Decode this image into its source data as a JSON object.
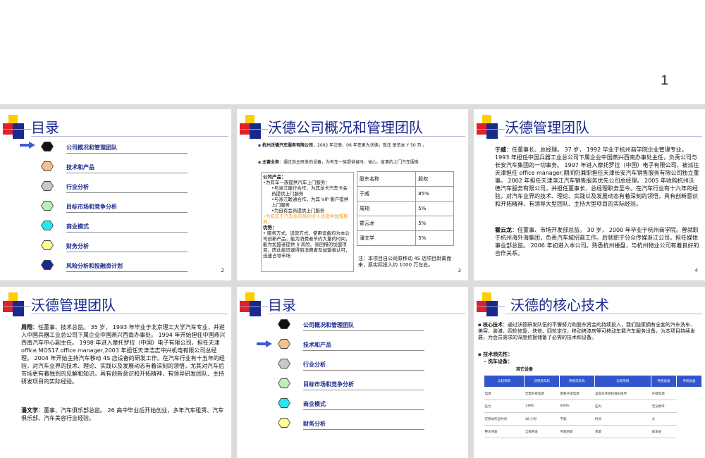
{
  "top": {
    "page": "1"
  },
  "s2": {
    "title": "目录",
    "num": "2",
    "items": [
      {
        "label": "公司概况和管理团队",
        "color": "#111111"
      },
      {
        "label": "技术和产品",
        "color": "#f8c08c"
      },
      {
        "label": "行业分析",
        "color": "#c8c8c8"
      },
      {
        "label": "目标市场和竞争分析",
        "color": "#b8f0b8"
      },
      {
        "label": "商业模式",
        "color": "#22e8f0"
      },
      {
        "label": "财务分析",
        "color": "#ffff99"
      },
      {
        "label": "风险分析和投融资计划",
        "color": "#1a2a8c"
      }
    ]
  },
  "s3": {
    "title": "沃德公司概况和管理团队",
    "num": "3",
    "b1_head": "杭州沃德汽车服务有限公司",
    "b1_text": "，2002 年注册，06 年变更为沃德，现注 册资本 Y 50 万 。",
    "b2_head": "主营业务",
    "b2_text": "：通过自主研发的设备，为有车一族提供省时、省心、省事的上门汽车服务",
    "box_head": "公司产品：",
    "box_lines": [
      "•为有车一族提供汽车上门服务：",
      "•与浙江建行合作，为其龙卡汽车卡会员提供上门服务",
      "•与浙江联通合作，为其 VIP 客户提供上门服务",
      "•为自有会员提供上门服务"
    ],
    "box_orange": "•为有志于汽车后市场创业人员提供加盟服务。",
    "adv_head": "优势：",
    "adv_text": "• 服务方式、运营方式、使用设备均为本公司创新产品，能为消费者节约大量的时间，能为加盟者提供 0 风险、高回报的加盟项目，因此能迅速得到消费者及加盟者认可，迅速占领市场",
    "table_head": [
      "股东名称",
      "股权"
    ],
    "table_rows": [
      [
        "于威",
        "85%"
      ],
      [
        "周翔",
        "5%"
      ],
      [
        "霍云龙",
        "5%"
      ],
      [
        "潘文学",
        "5%"
      ]
    ],
    "note": "注：本项目自公司原移动 4S 店项目剥离而来，原实际投入约 1000 万左右。"
  },
  "s4": {
    "title": "沃德管理团队",
    "num": "4",
    "p1_name": "于威",
    "p1_text": "：任董事长、总经理。 37 岁， 1992 毕业于杭州商学院企业管理专业。 1993 年担任中国兵器工业总公司下属企业中国燕兴西南办事处主任，负责公司与长安汽车集团的一切事务。 1997 年进入摩托罗拉（中国）电子有限公司，被派往天津担任 office manager,期间仍兼职担任天津长安汽车销售服务有限公司独立董事。 2002 年担任天津滨江汽车销售服务优先公司总经理。 2005 年收购杭州沃德汽车服务有限公司，并担任董事长、总经理职务至今。在汽车行业有十六年的经验，对汽车业界的技术、理论、实践以及发展动态有着深刻的领悟，具有创新意识和开拓精神，有领导大型团队、主持大型项目的实际经验。",
    "p2_name": "霍云龙",
    "p2_text": "：任董事、市场开发部总监。 30 岁， 2000 年毕业于杭州商学院。曾就职于杭州海外海集团，负责汽车城招商工作。后就职于分众传媒浙江公司，担任媒体事业部总监。 2006 年初进入本公司。熟悉杭州楼盘，与杭州物业公司有着良好的合作关系。"
  },
  "s5": {
    "title": "沃德管理团队",
    "p1_name": "周翔",
    "p1_text": "：任董事、技术总监。 35 岁， 1993 年毕业于北京理工大学汽车专业，并进入中国兵器工业总公司下属企业中国燕兴西南办事处。 1994 年开始担任中国燕兴西南汽车中心副主任。 1998 年进入摩托罗拉（中国）电子有限公司，担任天津 office MOS17 office manager,2003 年担任天津浩志中兴机电有限公司总经理。 2004 年开始主持汽车移动 4S 店设备的研发工作。在汽车行业有十五年的经验，对汽车业界的技术、理论、实践以及发展动态有着深刻的领悟，尤其对汽车后市场更有着独到的见解和知识。具有创新意识和开拓精神，有领导研发团队、主持研发项目的实际经验。",
    "p2_name": "潘文学",
    "p2_text": "：董事、汽车俱乐部总监。 26 高中毕业后开始创业，多年汽车租赁、汽车俱乐部、汽车美容行业经验。"
  },
  "s6": {
    "title": "目录",
    "items": [
      {
        "label": "公司概况和管理团队",
        "color": "#111111"
      },
      {
        "label": "技术和产品",
        "color": "#f8c08c"
      },
      {
        "label": "行业分析",
        "color": "#c8c8c8"
      },
      {
        "label": "目标市场和竞争分析",
        "color": "#b8f0b8"
      },
      {
        "label": "商业模式",
        "color": "#22e8f0"
      },
      {
        "label": "财务分析",
        "color": "#ffff99"
      }
    ]
  },
  "s7": {
    "title": "沃德的核心技术",
    "b1_head": "核心技术",
    "b1_text": "：通过沃德研发队伍的不懈努力和股东资金的持续投入，我们独家拥有全套的汽车洗车、美容、装潢、四轮修复、快修、四轮定位，移动烤漆房等可移动车载汽车服务设备，为本项目持续发展，为会员需求的深度挖掘储备了必需的技术和设备。",
    "b2": "技术领先性：",
    "b3": "洗车设备：",
    "sub": "其它设备",
    "th": [
      "比较项目",
      "沃德洗车机",
      "传统洗车机",
      "比较项目",
      "传统设备",
      "传统设备"
    ],
    "rows": [
      [
        "电源",
        "无需外接电源",
        "需要外接电源",
        "美容车体保险抵扣损坏",
        "外接电源"
      ],
      [
        "压力",
        "13MG",
        "60MG",
        "压力",
        "无法携带"
      ],
      [
        "可移动作业时间",
        "48 小时",
        "不能",
        "时间",
        "大"
      ],
      [
        "整水回收",
        "全部回收",
        "不能回收",
        "风量",
        "成本低"
      ]
    ]
  }
}
